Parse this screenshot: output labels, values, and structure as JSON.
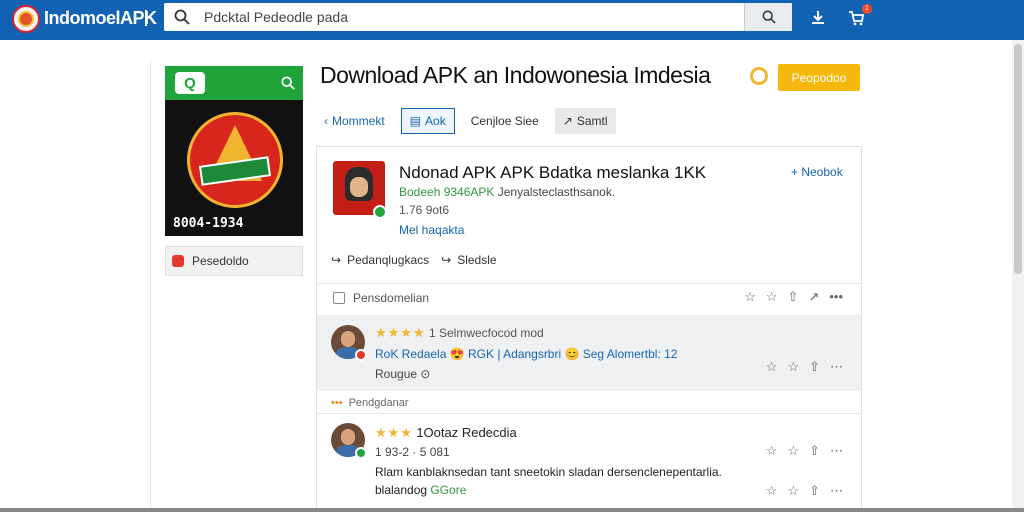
{
  "header": {
    "brand": "IndomoelAPK",
    "search_placeholder": "Pdcktal Pedeodle pada",
    "bg_color": "#1262b3"
  },
  "sidebar": {
    "promo_code": "8004-1934",
    "item_label": "Pesedoldo"
  },
  "main": {
    "title": "Download APK an Indowonesia Imdesia",
    "primary_button": "Peopodoo",
    "tabs": [
      {
        "label": "Mommekt",
        "icon": "chevron-left-icon"
      },
      {
        "label": "Aok",
        "icon": "doc-icon"
      },
      {
        "label": "Cenjloe Siee",
        "icon": ""
      },
      {
        "label": "Samtl",
        "icon": "share-icon"
      }
    ]
  },
  "app": {
    "name": "Ndonad APK APK  Bdatka meslanka 1KK",
    "sub_green": "Bodeeh 9346APK",
    "sub_rest": " Jenyalsteclasthsanok.",
    "size": "1.76  9ot6",
    "link": "Mel haqakta",
    "follow": "Neobok",
    "share_1": "Pedanqlugkacs",
    "share_2": "Sledsle"
  },
  "reviews_section": {
    "label": "Pensdomelian",
    "actions": [
      "☆",
      "☆",
      "⇧",
      "↗",
      "•••"
    ]
  },
  "reviews": [
    {
      "stars": "★★★★",
      "meta": "1 Selmwecfocod mod",
      "body": "RoK Redaela 😍 RGK | Adangsrbri 😊 Seg Alomertbl: 12",
      "footer": "Rougue ⊙",
      "badge_color": "#e23b2e"
    },
    {
      "stars": "★★★",
      "meta": "1Ootaz Redecdia",
      "date": "1 93-2 · 5 081",
      "body": "Rlam kanblaknsedan tant sneetokin sladan dersenclenepentarlia.",
      "footer_prefix": "blalandog ",
      "footer_green": "GGore",
      "badge_color": "#22a43a"
    }
  ],
  "reviews_subhead": "Pendgdanar",
  "review_actions": [
    "☆",
    "☆",
    "⇧",
    "⋯"
  ],
  "review2_actions": [
    "☆",
    "☆",
    "⇧",
    "⋯"
  ]
}
